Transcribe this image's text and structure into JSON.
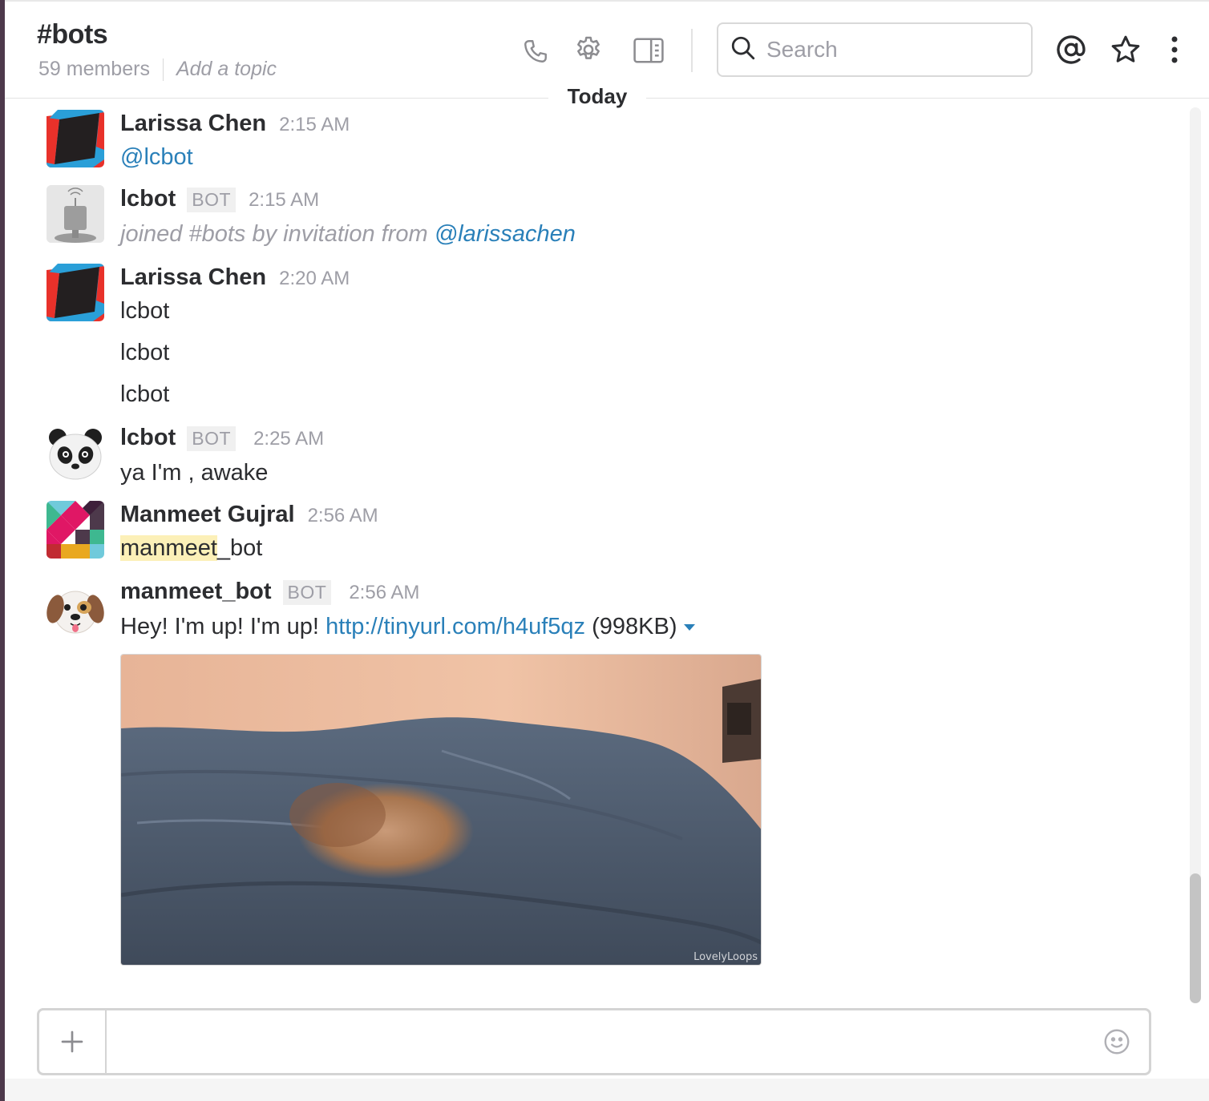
{
  "channel": {
    "name": "#bots",
    "members": "59 members",
    "topic_placeholder": "Add a topic"
  },
  "header": {
    "icons": [
      "phone-icon",
      "gear-icon",
      "sidebar-toggle-icon",
      "search-icon",
      "at-mention-icon",
      "star-icon",
      "more-vertical-icon"
    ],
    "search_placeholder": "Search"
  },
  "day_divider": "Today",
  "messages": [
    {
      "sender": "Larissa Chen",
      "time": "2:15 AM",
      "lines": [
        "@lcbot"
      ]
    },
    {
      "sender": "lcbot",
      "tag": "BOT",
      "time": "2:15 AM",
      "system_text": "joined #bots by invitation from",
      "mention": "@larissachen"
    },
    {
      "sender": "Larissa Chen",
      "time": "2:20 AM",
      "lines": [
        "lcbot",
        "lcbot",
        "lcbot"
      ]
    },
    {
      "sender": "lcbot",
      "tag": "BOT",
      "time": "2:25 AM",
      "lines": [
        "ya I'm , awake"
      ]
    },
    {
      "sender": "Manmeet Gujral",
      "time": "2:56 AM",
      "highlight": "manmeet",
      "rest": "_bot"
    },
    {
      "sender": "manmeet_bot",
      "tag": "BOT",
      "time": "2:56 AM",
      "text": "Hey! I'm up! I'm up!",
      "link": "http://tinyurl.com/h4uf5qz",
      "size": "(998KB)",
      "gif_watermark": "LovelyLoops"
    }
  ],
  "composer": {
    "placeholder": ""
  },
  "colors": {
    "link": "#2a80b9",
    "highlight": "#fcf0b8",
    "muted": "#9e9ea6",
    "sidebar_edge": "#4d394b"
  }
}
